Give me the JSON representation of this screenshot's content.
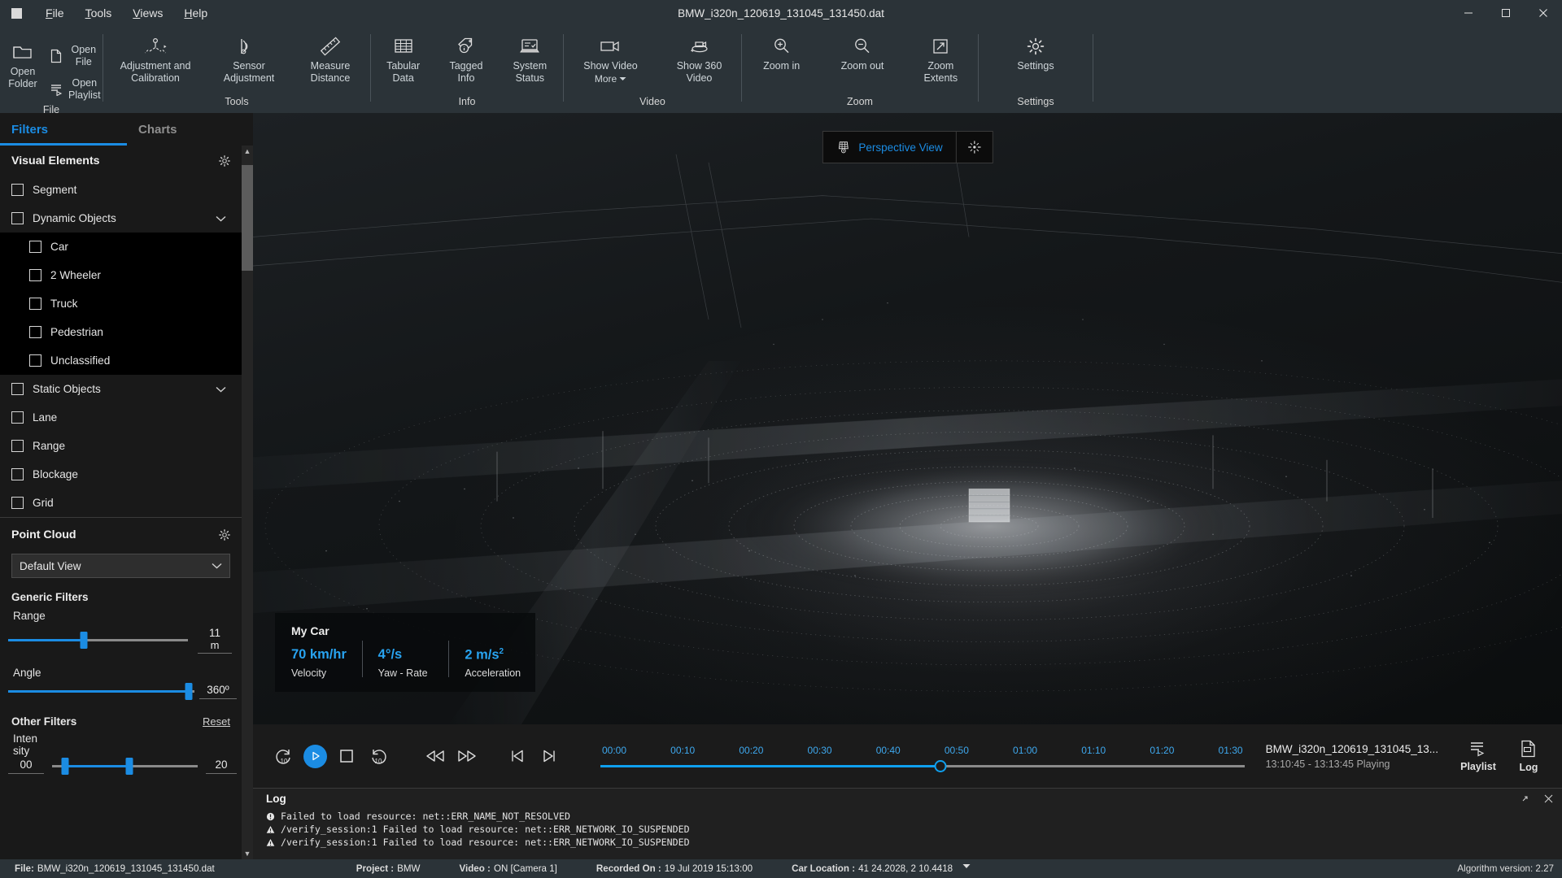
{
  "titlebar": {
    "menus": [
      "File",
      "Tools",
      "Views",
      "Help"
    ],
    "title": "BMW_i320n_120619_131045_131450.dat",
    "minimize": "—",
    "maximize": "❐",
    "close": "✕"
  },
  "ribbon": {
    "groups": [
      {
        "label": "File",
        "buttons": [
          {
            "name": "open-folder",
            "label": "Open\nFolder",
            "icon": "folder-icon"
          },
          {
            "name": "open-file",
            "label": "Open File",
            "icon": "file-icon"
          },
          {
            "name": "open-playlist",
            "label": "Open Playlist",
            "icon": "playlist-icon"
          }
        ]
      },
      {
        "label": "Tools",
        "buttons": [
          {
            "name": "adjustment-and-calibration",
            "label": "Adjustment and\nCalibration",
            "icon": "calibration-icon"
          },
          {
            "name": "sensor-adjustment",
            "label": "Sensor\nAdjustment",
            "icon": "sensor-icon"
          },
          {
            "name": "measure-distance",
            "label": "Measure\nDistance",
            "icon": "ruler-icon"
          }
        ]
      },
      {
        "label": "Info",
        "buttons": [
          {
            "name": "tabular-data",
            "label": "Tabular\nData",
            "icon": "table-icon"
          },
          {
            "name": "tagged-info",
            "label": "Tagged\nInfo",
            "icon": "tag-icon"
          },
          {
            "name": "system-status",
            "label": "System\nStatus",
            "icon": "monitor-icon"
          }
        ]
      },
      {
        "label": "Video",
        "buttons": [
          {
            "name": "show-video",
            "label": "Show Video",
            "icon": "video-camera-icon",
            "more": "More"
          },
          {
            "name": "show-360-video",
            "label": "Show 360\nVideo",
            "icon": "video-360-icon"
          }
        ]
      },
      {
        "label": "Zoom",
        "buttons": [
          {
            "name": "zoom-in",
            "label": "Zoom in",
            "icon": "zoom-in-icon"
          },
          {
            "name": "zoom-out",
            "label": "Zoom out",
            "icon": "zoom-out-icon"
          },
          {
            "name": "zoom-extents",
            "label": "Zoom\nExtents",
            "icon": "zoom-extents-icon"
          }
        ]
      },
      {
        "label": "Settings",
        "buttons": [
          {
            "name": "settings",
            "label": "Settings",
            "icon": "gear-icon"
          }
        ]
      }
    ]
  },
  "sidebar": {
    "tabs": [
      {
        "label": "Filters",
        "active": true
      },
      {
        "label": "Charts",
        "active": false
      }
    ],
    "visual_elements": {
      "heading": "Visual Elements",
      "items": [
        {
          "label": "Segment",
          "checked": false,
          "nested": false,
          "expandable": false
        },
        {
          "label": "Dynamic Objects",
          "checked": false,
          "nested": false,
          "expandable": true
        },
        {
          "label": "Car",
          "checked": false,
          "nested": true,
          "expandable": false
        },
        {
          "label": "2 Wheeler",
          "checked": false,
          "nested": true,
          "expandable": false
        },
        {
          "label": "Truck",
          "checked": false,
          "nested": true,
          "expandable": false
        },
        {
          "label": "Pedestrian",
          "checked": false,
          "nested": true,
          "expandable": false
        },
        {
          "label": "Unclassified",
          "checked": false,
          "nested": true,
          "expandable": false
        },
        {
          "label": "Static Objects",
          "checked": false,
          "nested": false,
          "expandable": true
        },
        {
          "label": "Lane",
          "checked": false,
          "nested": false,
          "expandable": false
        },
        {
          "label": "Range",
          "checked": false,
          "nested": false,
          "expandable": false
        },
        {
          "label": "Blockage",
          "checked": false,
          "nested": false,
          "expandable": false
        },
        {
          "label": "Grid",
          "checked": false,
          "nested": false,
          "expandable": false
        }
      ]
    },
    "point_cloud": {
      "heading": "Point Cloud",
      "view_select": "Default View",
      "generic_filters_heading": "Generic Filters",
      "range": {
        "label": "Range",
        "value": "11",
        "unit": "m",
        "percent": 42
      },
      "angle": {
        "label": "Angle",
        "value": "360º",
        "percent": 97
      },
      "other_filters_heading": "Other Filters",
      "reset_label": "Reset",
      "intensity": {
        "label": "Intensity",
        "min_value": "00",
        "max_value": "20",
        "low_percent": 9,
        "high_percent": 53
      }
    }
  },
  "viewport": {
    "view_mode": "Perspective View",
    "view_mode_icon": "perspective-cube-icon",
    "recenter_icon": "recenter-icon",
    "mycar": {
      "title": "My Car",
      "metrics": [
        {
          "value": "70 km/hr",
          "label": "Velocity"
        },
        {
          "value": "4°/s",
          "label": "Yaw - Rate"
        },
        {
          "value": "2 m/s",
          "sup": "2",
          "label": "Acceleration"
        }
      ]
    }
  },
  "player": {
    "controls": [
      {
        "name": "rewind-10-button",
        "icon": "replay-10-icon"
      },
      {
        "name": "play-button",
        "icon": "play-icon"
      },
      {
        "name": "stop-button",
        "icon": "stop-icon"
      },
      {
        "name": "forward-10-button",
        "icon": "forward-10-icon"
      },
      {
        "name": "previous-frame-fast-button",
        "icon": "rewind-icon"
      },
      {
        "name": "next-frame-fast-button",
        "icon": "fast-forward-icon"
      },
      {
        "name": "skip-to-start-button",
        "icon": "skip-start-icon"
      },
      {
        "name": "skip-to-end-button",
        "icon": "skip-end-icon"
      }
    ],
    "timeline": {
      "ticks": [
        "00:00",
        "00:10",
        "00:20",
        "00:30",
        "00:40",
        "00:50",
        "01:00",
        "01:10",
        "01:20",
        "01:30"
      ],
      "progress_percent": 52.8
    },
    "file_name": "BMW_i320n_120619_131045_13...",
    "file_status": "13:10:45 - 13:13:45 Playing",
    "playlist_label": "Playlist",
    "log_label": "Log"
  },
  "log": {
    "title": "Log",
    "expand_icon": "expand-icon",
    "close_icon": "close-icon",
    "lines": [
      {
        "level": "error",
        "text": "Failed to load resource: net::ERR_NAME_NOT_RESOLVED"
      },
      {
        "level": "warn",
        "text": "/verify_session:1 Failed to load resource: net::ERR_NETWORK_IO_SUSPENDED"
      },
      {
        "level": "warn",
        "text": "/verify_session:1 Failed to load resource: net::ERR_NETWORK_IO_SUSPENDED"
      }
    ]
  },
  "statusbar": {
    "items": [
      {
        "key": "File:",
        "value": "BMW_i320n_120619_131045_131450.dat"
      },
      {
        "key": "Project :",
        "value": "BMW"
      },
      {
        "key": "Video :",
        "value": "ON [Camera 1]"
      },
      {
        "key": "Recorded On :",
        "value": "19 Jul 2019  15:13:00"
      },
      {
        "key": "Car Location :",
        "value": "41 24.2028, 2 10.4418"
      }
    ],
    "location_dropdown_icon": "caret-down-icon",
    "right": "Algorithm version: 2.27"
  },
  "colors": {
    "accent": "#1b8ce3",
    "chrome": "#2b3338",
    "panel": "#191919",
    "viewport": "#060606"
  }
}
